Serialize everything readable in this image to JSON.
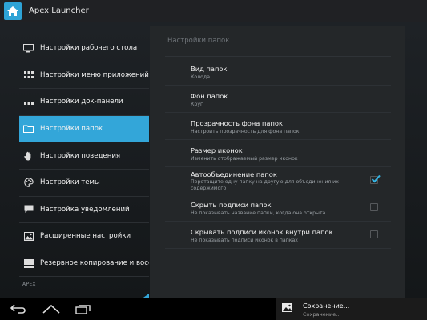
{
  "app": {
    "title": "Apex Launcher"
  },
  "sidebar": {
    "items": [
      {
        "label": "Настройки рабочего стола",
        "icon": "monitor-icon"
      },
      {
        "label": "Настройки меню приложений",
        "icon": "grid-icon"
      },
      {
        "label": "Настройки док-панели",
        "icon": "dock-icon"
      },
      {
        "label": "Настройки папок",
        "icon": "folder-icon",
        "active": true
      },
      {
        "label": "Настройки поведения",
        "icon": "hand-icon"
      },
      {
        "label": "Настройки темы",
        "icon": "palette-icon"
      },
      {
        "label": "Настройка уведомлений",
        "icon": "notification-icon"
      },
      {
        "label": "Расширенные настройки",
        "icon": "advanced-icon"
      },
      {
        "label": "Резервное копирование и восс",
        "icon": "backup-icon"
      }
    ],
    "section_label": "APEX"
  },
  "panel": {
    "title": "Настройки папок",
    "prefs": [
      {
        "title": "Вид папок",
        "summary": "Колода"
      },
      {
        "title": "Фон папок",
        "summary": "Круг"
      },
      {
        "title": "Прозрачность фона папок",
        "summary": "Настроить прозрачность для фона папок"
      },
      {
        "title": "Размер иконок",
        "summary": "Изменить отображаемый размер иконок"
      },
      {
        "title": "Автообъединение папок",
        "summary": "Перетащите одну папку на другую для объединения их содержимого",
        "checked": true
      },
      {
        "title": "Скрыть подписи папок",
        "summary": "Не показывать название папки, когда она открыта",
        "checked": false
      },
      {
        "title": "Скрывать подписи иконок внутри папок",
        "summary": "Не показывать подписи иконок в папках",
        "checked": false
      }
    ]
  },
  "navbar": {
    "buttons": [
      "back-icon",
      "home-icon",
      "recent-apps-icon"
    ]
  },
  "notification": {
    "title": "Сохранение...",
    "subtitle": "Сохранение...",
    "icon": "image-icon"
  },
  "colors": {
    "accent": "#33a6d9",
    "check": "#33b5e5"
  }
}
